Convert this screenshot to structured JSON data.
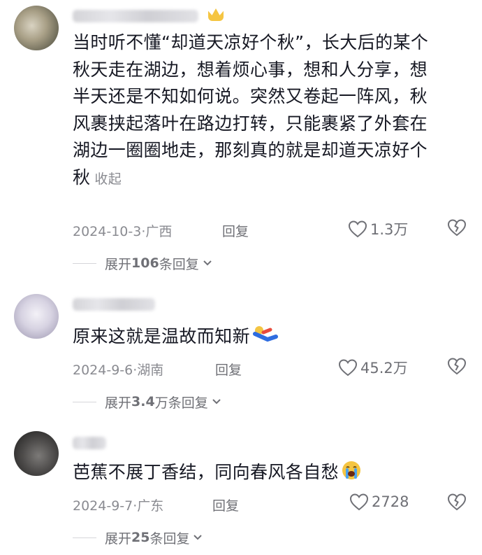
{
  "comments": [
    {
      "text_lines": [
        "当时听不懂“却道天凉好个秋”，长大后的某个",
        "秋天走在湖边，想着烦心事，想和人分享，想",
        "半天还是不知如何说。突然又卷起一阵风，秋",
        "风裹挟起落叶在路边打转，只能裹紧了外套在",
        "湖边一圈圈地走，那刻真的就是却道天凉好个",
        "秋"
      ],
      "collapse_label": "收起",
      "date_location": "2024-10-3·广西",
      "reply_label": "回复",
      "likes": "1.3万",
      "expand": {
        "prefix": "展开",
        "count": "106",
        "suffix": "条回复"
      }
    },
    {
      "text_lines": [
        "原来这就是温故而知新"
      ],
      "date_location": "2024-9-6·湖南",
      "reply_label": "回复",
      "likes": "45.2万",
      "expand": {
        "prefix": "展开",
        "count": "3.4",
        "suffix": "万条回复"
      }
    },
    {
      "text_lines": [
        "芭蕉不展丁香结，同向春风各自愁"
      ],
      "date_location": "2024-9-7·广东",
      "reply_label": "回复",
      "likes": "2728",
      "expand": {
        "prefix": "展开",
        "count": "25",
        "suffix": "条回复"
      }
    }
  ],
  "icons": {
    "like": "heart-outline-icon",
    "dislike": "broken-heart-icon",
    "expand": "chevron-down-icon",
    "emoji_1": "sliding-person-emoji",
    "emoji_2": "loudly-crying-face-emoji",
    "badge": "crown-badge-icon"
  },
  "colors": {
    "text": "#161823",
    "meta": "#8a8b91",
    "background": "#ffffff"
  }
}
